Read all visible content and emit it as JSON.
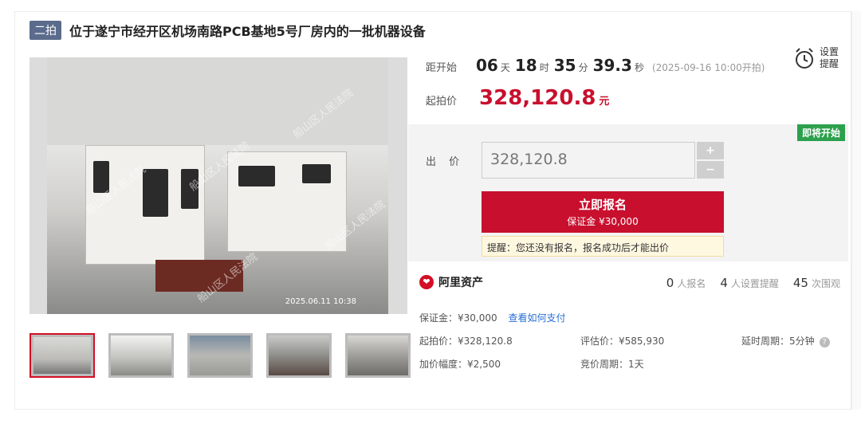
{
  "header": {
    "badge": "二拍",
    "title": "位于遂宁市经开区机场南路PCB基地5号厂房内的一批机器设备"
  },
  "gallery": {
    "watermark": "船山区人民法院",
    "stamp": "2025.06.11 10:38",
    "thumb_count": 5
  },
  "countdown": {
    "label": "距开始",
    "days": "06",
    "days_unit": "天",
    "hours": "18",
    "hours_unit": "时",
    "minutes": "35",
    "minutes_unit": "分",
    "seconds": "39.3",
    "seconds_unit": "秒",
    "start_note": "(2025-09-16 10:00开拍)"
  },
  "reminder": {
    "line1": "设置",
    "line2": "提醒",
    "icon": "alarm-clock-icon"
  },
  "start_price": {
    "label": "起拍价",
    "value": "328,120.8",
    "unit": "元"
  },
  "bid": {
    "status_badge": "即将开始",
    "label": "出 价",
    "input_value": "328,120.8",
    "plus": "+",
    "minus": "−",
    "signup_label": "立即报名",
    "deposit_label": "保证金 ¥30,000",
    "tip": "提醒：您还没有报名，报名成功后才能出价"
  },
  "platform": {
    "name": "阿里资产"
  },
  "stats": {
    "signups": "0",
    "signups_label": "人报名",
    "reminders": "4",
    "reminders_label": "人设置提醒",
    "views": "45",
    "views_label": "次围观"
  },
  "details": {
    "deposit": "保证金：¥30,000",
    "pay_link": "查看如何支付",
    "start_price": "起拍价：¥328,120.8",
    "appraisal": "评估价：¥585,930",
    "delay": "延时周期：5分钟",
    "increment": "加价幅度：¥2,500",
    "bid_period": "竞价周期：1天"
  },
  "colors": {
    "accent": "#c8102e",
    "badge": "#5b6b8c",
    "start_soon": "#2ca04c",
    "link": "#2a6fd6"
  }
}
